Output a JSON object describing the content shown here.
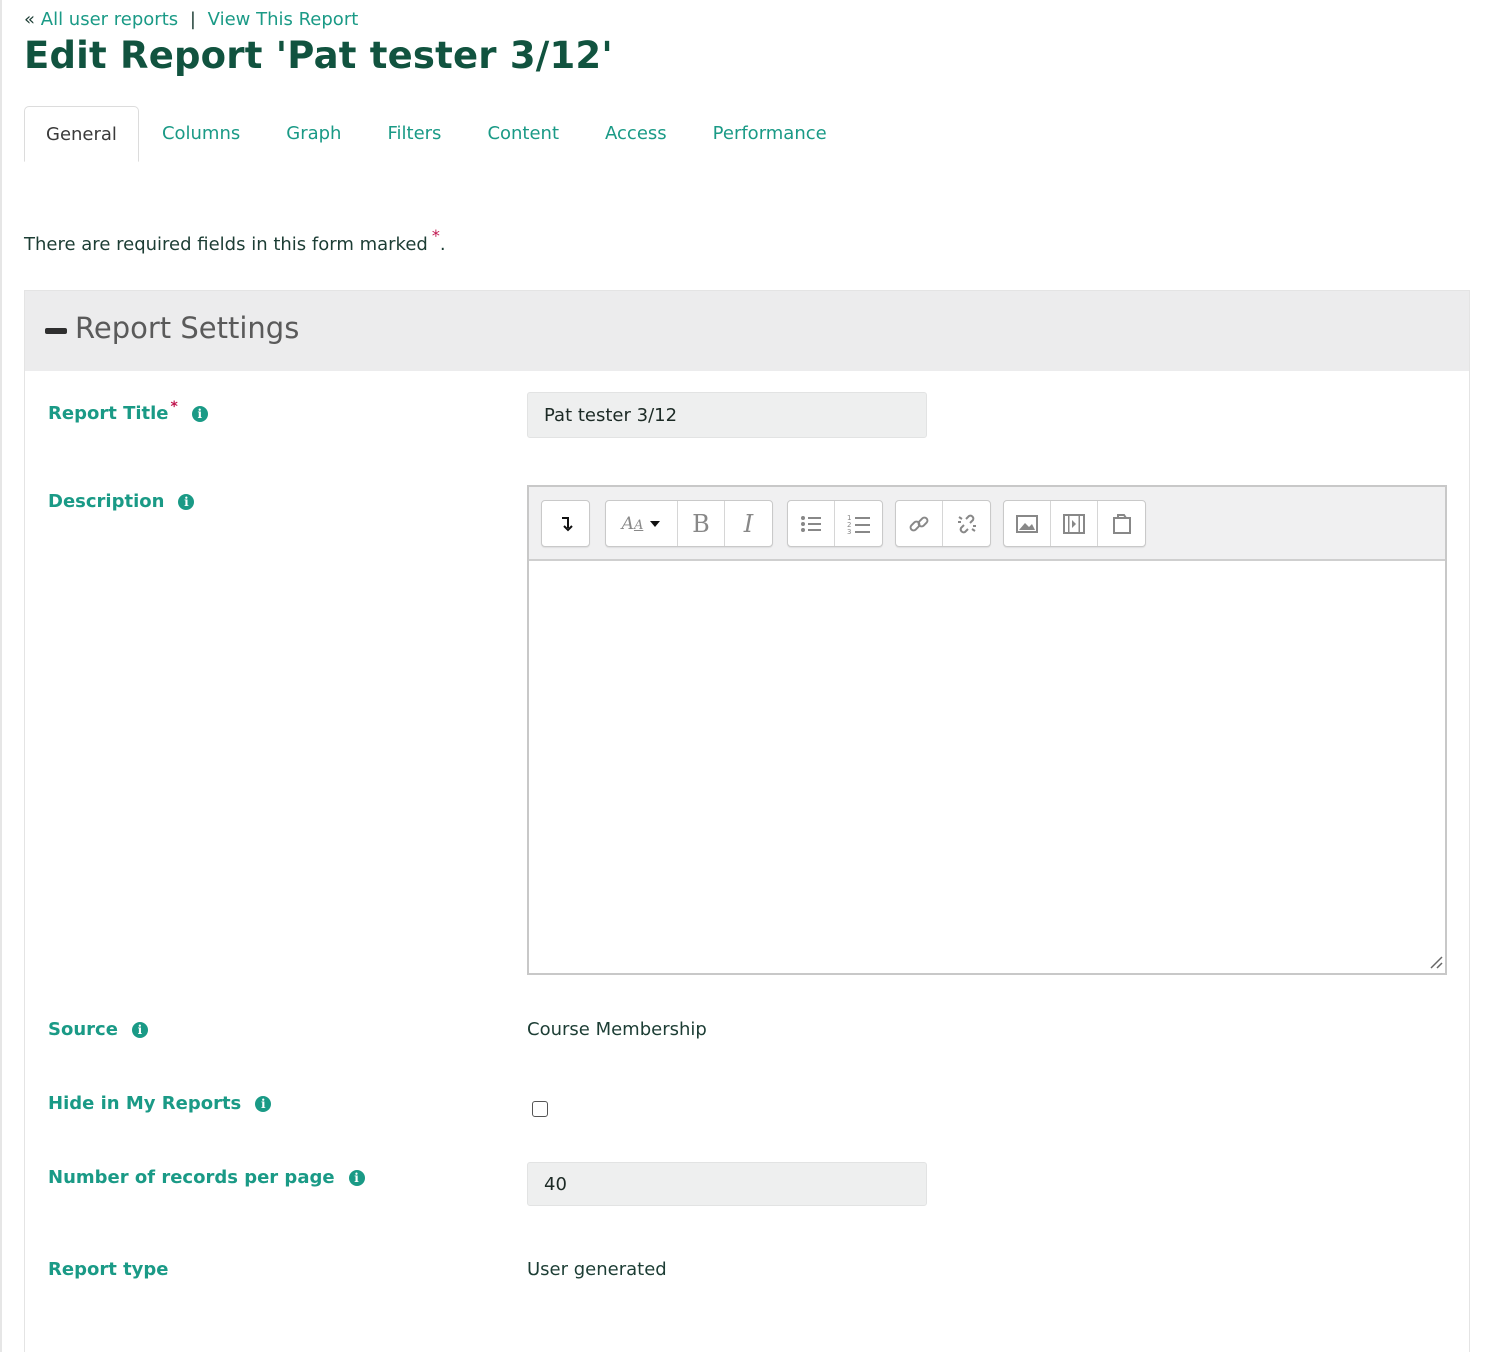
{
  "breadcrumb": {
    "prefix": "«",
    "all_reports": "All user reports",
    "separator": "|",
    "view_report": "View This Report"
  },
  "page_title": "Edit Report 'Pat tester 3/12'",
  "tabs": [
    {
      "label": "General",
      "active": true
    },
    {
      "label": "Columns",
      "active": false
    },
    {
      "label": "Graph",
      "active": false
    },
    {
      "label": "Filters",
      "active": false
    },
    {
      "label": "Content",
      "active": false
    },
    {
      "label": "Access",
      "active": false
    },
    {
      "label": "Performance",
      "active": false
    }
  ],
  "required_note": {
    "text": "There are required fields in this form marked",
    "star": "*",
    "period": "."
  },
  "section": {
    "title": "Report Settings",
    "fields": {
      "report_title": {
        "label": "Report Title",
        "star": "*",
        "value": "Pat tester 3/12"
      },
      "description": {
        "label": "Description",
        "value": ""
      },
      "source": {
        "label": "Source",
        "value": "Course Membership"
      },
      "hide": {
        "label": "Hide in My Reports",
        "checked": false
      },
      "records": {
        "label": "Number of records per page",
        "value": "40"
      },
      "report_type": {
        "label": "Report type",
        "value": "User generated"
      }
    }
  },
  "editor_toolbar": {
    "groups": [
      [
        "toggle-toolbar-icon"
      ],
      [
        "font-style-icon",
        "bold-icon",
        "italic-icon"
      ],
      [
        "bullet-list-icon",
        "numbered-list-icon"
      ],
      [
        "link-icon",
        "unlink-icon"
      ],
      [
        "image-icon",
        "media-icon",
        "manage-files-icon"
      ]
    ]
  },
  "colors": {
    "accent": "#1a9a86",
    "title": "#11533f",
    "required": "#c0144d"
  }
}
